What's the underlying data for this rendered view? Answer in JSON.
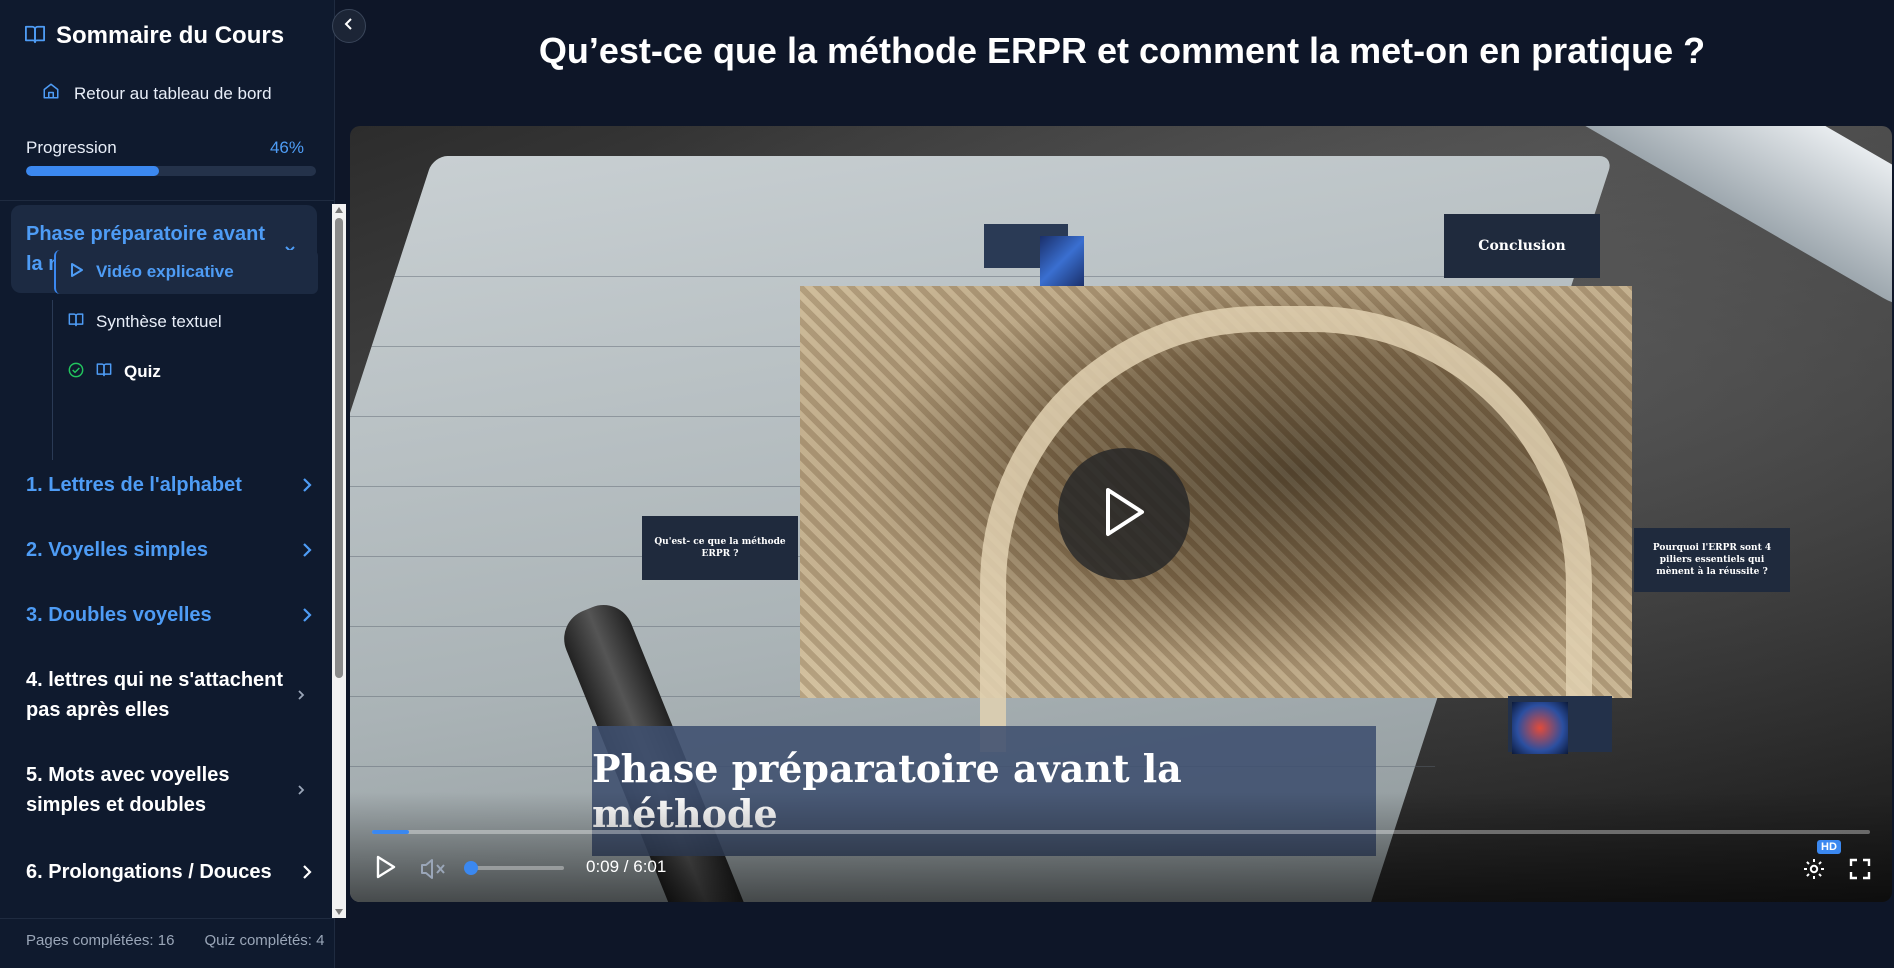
{
  "sidebar": {
    "title": "Sommaire du Cours",
    "back_link": "Retour au tableau de bord",
    "progress_label": "Progression",
    "progress_pct": "46%",
    "progress_value": 0.46,
    "active_section": "Phase préparatoire avant la méthode",
    "sub_items": [
      {
        "label": "Vidéo explicative",
        "icon": "play-icon",
        "active": true
      },
      {
        "label": "Synthèse textuel",
        "icon": "book-icon",
        "active": false
      },
      {
        "label": "Quiz",
        "icon": "book-icon",
        "completed": true
      }
    ],
    "sections": [
      "1. Lettres de l'alphabet",
      "2. Voyelles simples",
      "3. Doubles voyelles",
      "4. lettres qui ne s'attachent pas après elles",
      "5. Mots avec voyelles simples et doubles",
      "6. Prolongations / Douces"
    ],
    "footer": {
      "pages": "Pages complétées: 16",
      "quiz": "Quiz complétés: 4"
    }
  },
  "page_title": "Qu’est-ce que la méthode ERPR et comment la met-on en pratique ?",
  "video": {
    "slide_cards": {
      "left": "Qu'est- ce que la méthode ERPR ?",
      "right": "Pourquoi l'ERPR sont 4 piliers essentiels qui mènent à la réussite ?",
      "conclusion": "Conclusion"
    },
    "caption": "Phase préparatoire avant la méthode",
    "time": "0:09 / 6:01",
    "progress_value": 0.025,
    "volume_value": 0,
    "hd_badge": "HD"
  },
  "colors": {
    "accent": "#3b88f0",
    "accent_text": "#4e9cf5",
    "background": "#0e1628",
    "sidebar": "#0f1a2e",
    "completed": "#22c55e"
  }
}
